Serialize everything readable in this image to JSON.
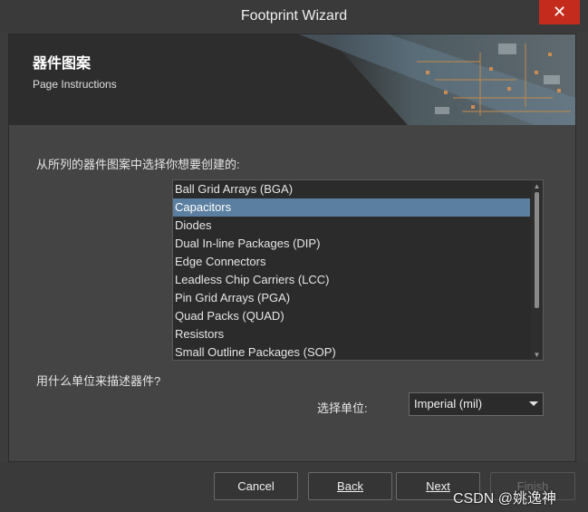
{
  "window": {
    "title": "Footprint Wizard",
    "close_glyph": "✕"
  },
  "banner": {
    "title": "器件图案",
    "subtitle": "Page Instructions"
  },
  "main": {
    "prompt": "从所列的器件图案中选择你想要创建的:",
    "items": [
      {
        "label": "Ball Grid Arrays (BGA)",
        "selected": false
      },
      {
        "label": "Capacitors",
        "selected": true
      },
      {
        "label": "Diodes",
        "selected": false
      },
      {
        "label": "Dual In-line Packages (DIP)",
        "selected": false
      },
      {
        "label": "Edge Connectors",
        "selected": false
      },
      {
        "label": "Leadless Chip Carriers (LCC)",
        "selected": false
      },
      {
        "label": "Pin Grid Arrays (PGA)",
        "selected": false
      },
      {
        "label": "Quad Packs (QUAD)",
        "selected": false
      },
      {
        "label": "Resistors",
        "selected": false
      },
      {
        "label": "Small Outline Packages (SOP)",
        "selected": false
      }
    ],
    "unit_prompt": "用什么单位来描述器件?",
    "unit_label": "选择单位:",
    "unit_value": "Imperial (mil)"
  },
  "footer": {
    "cancel": "Cancel",
    "back": "Back",
    "next": "Next",
    "finish": "Finish"
  },
  "watermark": "CSDN @姚逸神",
  "colors": {
    "selection": "#5b7fa0",
    "close": "#c42b1c",
    "background": "#3c3c3c"
  }
}
